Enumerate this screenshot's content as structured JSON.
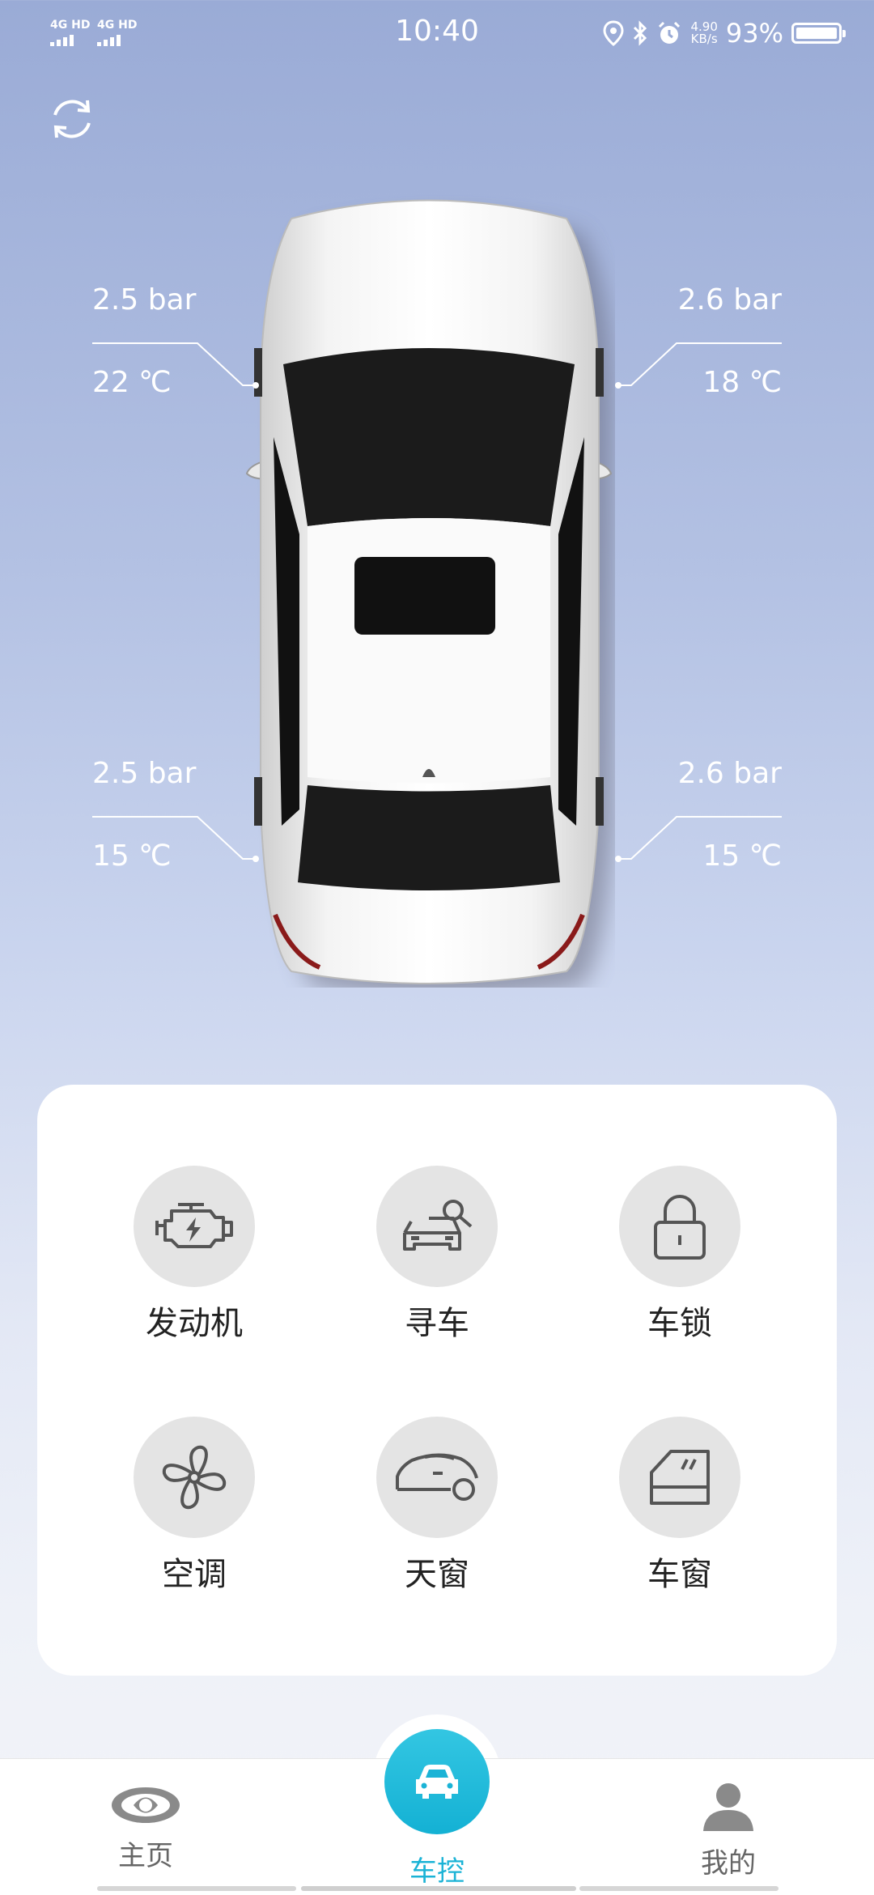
{
  "status_bar": {
    "signal1": "4G HD",
    "signal2": "4G HD",
    "time": "10:40",
    "net_speed_value": "4.90",
    "net_speed_unit": "KB/s",
    "battery": "93%"
  },
  "tires": {
    "front_left": {
      "pressure": "2.5 bar",
      "temp": "22 ℃"
    },
    "front_right": {
      "pressure": "2.6 bar",
      "temp": "18 ℃"
    },
    "rear_left": {
      "pressure": "2.5 bar",
      "temp": "15 ℃"
    },
    "rear_right": {
      "pressure": "2.6 bar",
      "temp": "15 ℃"
    }
  },
  "controls": [
    {
      "label": "发动机",
      "icon": "engine-icon"
    },
    {
      "label": "寻车",
      "icon": "find-car-icon"
    },
    {
      "label": "车锁",
      "icon": "lock-icon"
    },
    {
      "label": "空调",
      "icon": "fan-icon"
    },
    {
      "label": "天窗",
      "icon": "sunroof-icon"
    },
    {
      "label": "车窗",
      "icon": "window-icon"
    }
  ],
  "nav": {
    "home": "主页",
    "control": "车控",
    "mine": "我的"
  },
  "colors": {
    "accent": "#1bb3d6",
    "icon_gray": "#555555",
    "circle_bg": "#e4e4e4"
  }
}
